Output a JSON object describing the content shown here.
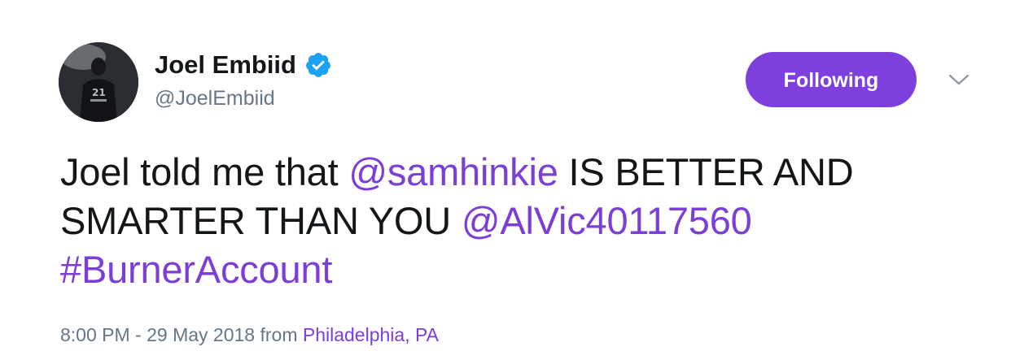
{
  "tweet": {
    "author": {
      "display_name": "Joel Embiid",
      "handle": "@JoelEmbiid",
      "verified": true
    },
    "follow_button": {
      "label": "Following",
      "color": "#7f3fdc"
    },
    "text": {
      "part1": "Joel told me that ",
      "mention1": "@samhinkie",
      "part2": " IS BETTER AND SMARTER THAN YOU ",
      "mention2": "@AlVic40117560",
      "part3": " ",
      "hashtag": "#BurnerAccount"
    },
    "meta": {
      "time": "8:00 PM",
      "separator": " - ",
      "date": "29 May 2018",
      "from": " from ",
      "location": "Philadelphia, PA"
    },
    "colors": {
      "link": "#7b3ed6",
      "muted": "#657786",
      "verified_badge": "#1da1f2"
    },
    "icons": {
      "verified": "verified-badge-icon",
      "caret": "chevron-down-icon"
    }
  }
}
